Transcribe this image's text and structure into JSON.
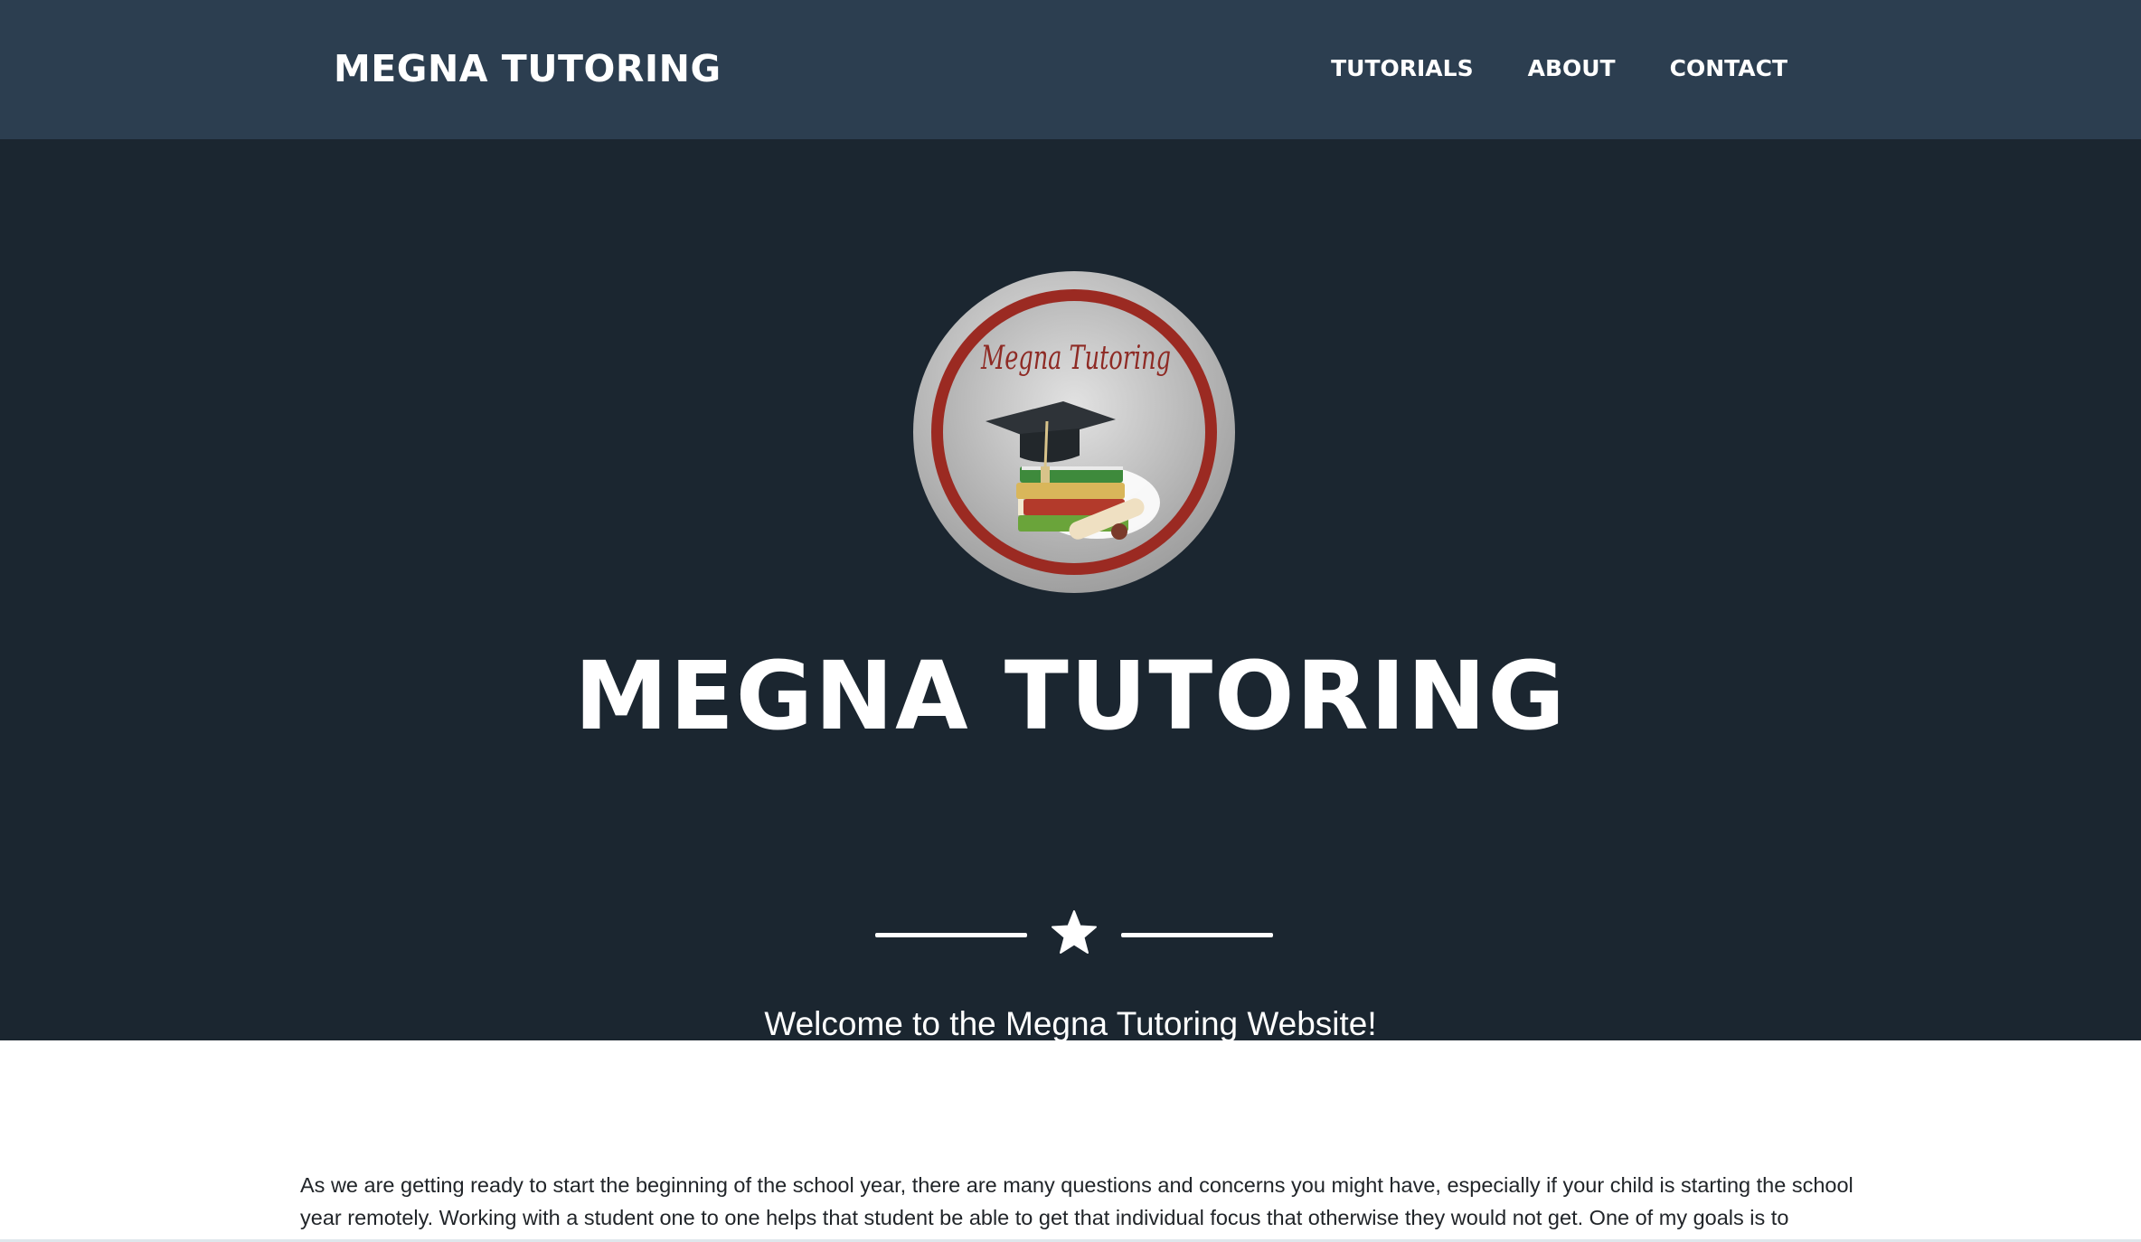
{
  "navbar": {
    "brand": "MEGNA TUTORING",
    "links": [
      {
        "label": "TUTORIALS"
      },
      {
        "label": "ABOUT"
      },
      {
        "label": "CONTACT"
      }
    ]
  },
  "masthead": {
    "logo_text": "Megna Tutoring",
    "title": "MEGNA TUTORING",
    "subtitle": "Welcome to the Megna Tutoring Website!",
    "divider_icon": "star-icon"
  },
  "content": {
    "paragraph": "As we are getting ready to start the beginning of the school year, there are many questions and concerns you might have, especially if your child is starting the school year remotely. Working with a student one to one helps that student be able to get that individual focus that otherwise they would not get. One of my goals is to"
  },
  "colors": {
    "navbar_bg": "#2c3e50",
    "masthead_bg": "#1b2630",
    "logo_ring": "#9b2a22",
    "text_dark": "#212529"
  }
}
